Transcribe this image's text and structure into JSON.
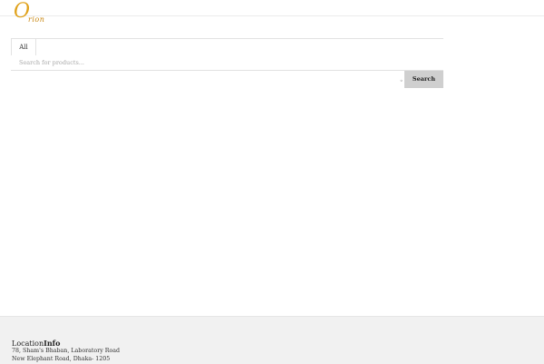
{
  "brand": {
    "logo_initial": "O",
    "logo_rest": "rion"
  },
  "search": {
    "category": "All",
    "placeholder": "Search for products...",
    "button_label": "Search"
  },
  "footer": {
    "title_plain": "Location",
    "title_bold": "Info",
    "address_line1": "78, Sham's Bhaban, Laboratory Road",
    "address_line2": "New Elephant Road, Dhaka- 1205"
  },
  "colors": {
    "logo": "#e0a21c",
    "button_bg": "#cfcfcf",
    "footer_bg": "#f1f1f1"
  }
}
